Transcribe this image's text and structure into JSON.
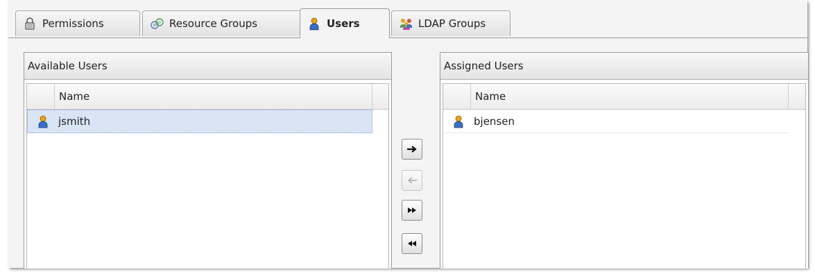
{
  "tabs": [
    {
      "label": "Permissions",
      "icon": "lock-icon"
    },
    {
      "label": "Resource Groups",
      "icon": "resource-groups-icon"
    },
    {
      "label": "Users",
      "icon": "user-icon",
      "active": true
    },
    {
      "label": "LDAP Groups",
      "icon": "ldap-groups-icon"
    }
  ],
  "available": {
    "title": "Available Users",
    "column": "Name",
    "rows": [
      {
        "name": "jsmith",
        "selected": true
      }
    ]
  },
  "assigned": {
    "title": "Assigned Users",
    "column": "Name",
    "rows": [
      {
        "name": "bjensen",
        "selected": false
      }
    ]
  },
  "buttons": {
    "add": {
      "glyph": "→",
      "enabled": true
    },
    "remove": {
      "glyph": "←",
      "enabled": false
    },
    "add_all": {
      "glyph": "▸▸",
      "enabled": true
    },
    "remove_all": {
      "glyph": "◂◂",
      "enabled": true
    }
  },
  "colors": {
    "selection": "#d9e4f5",
    "user_icon": "#e8a317",
    "user_icon_body": "#3b6fc4"
  }
}
